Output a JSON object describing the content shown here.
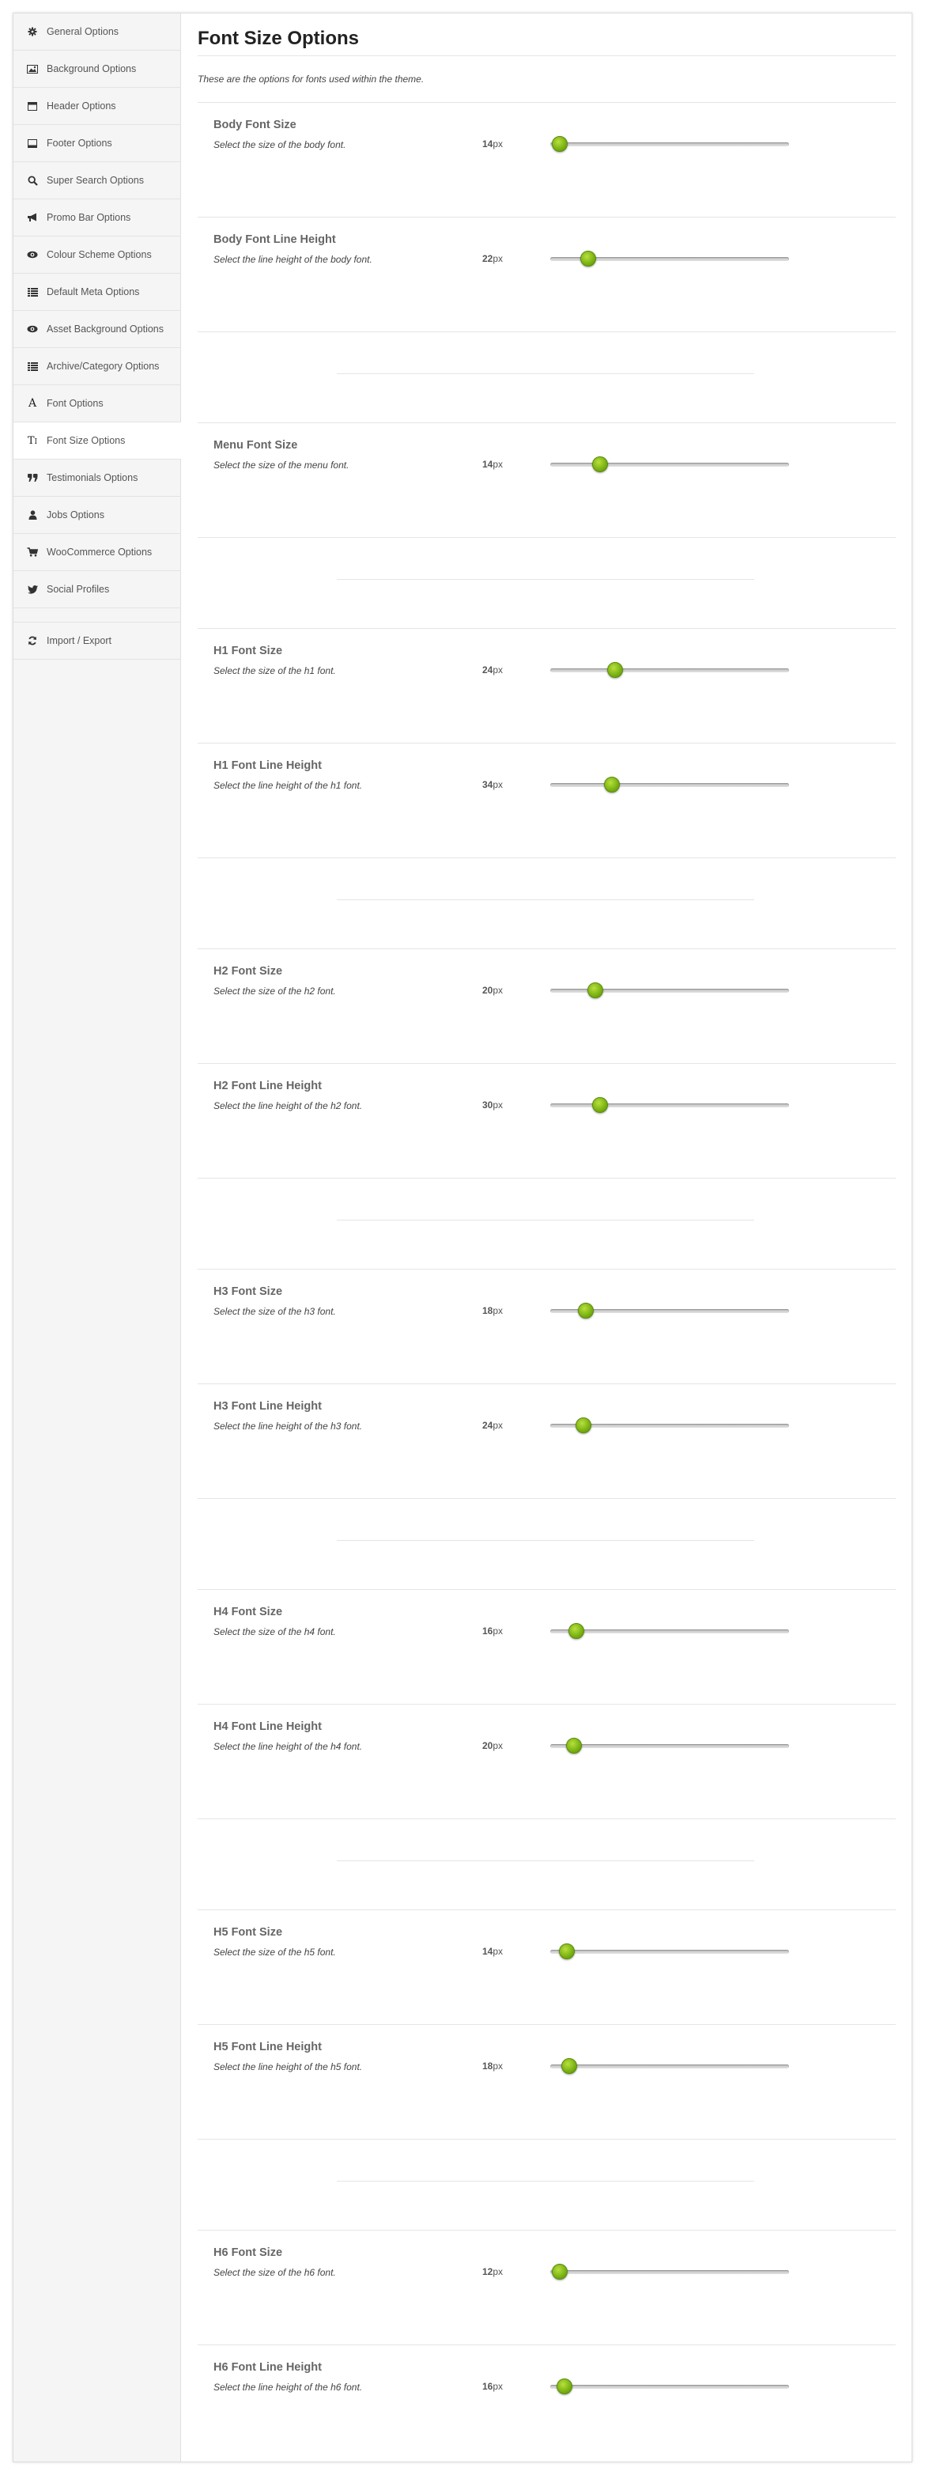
{
  "sidebar": {
    "items": [
      {
        "label": "General Options",
        "icon": "gear-icon",
        "active": false
      },
      {
        "label": "Background Options",
        "icon": "image-icon",
        "active": false
      },
      {
        "label": "Header Options",
        "icon": "header-icon",
        "active": false
      },
      {
        "label": "Footer Options",
        "icon": "footer-icon",
        "active": false
      },
      {
        "label": "Super Search Options",
        "icon": "search-icon",
        "active": false
      },
      {
        "label": "Promo Bar Options",
        "icon": "megaphone-icon",
        "active": false
      },
      {
        "label": "Colour Scheme Options",
        "icon": "eye-icon",
        "active": false
      },
      {
        "label": "Default Meta Options",
        "icon": "list-icon",
        "active": false
      },
      {
        "label": "Asset Background Options",
        "icon": "eye-icon",
        "active": false
      },
      {
        "label": "Archive/Category Options",
        "icon": "list-icon",
        "active": false
      },
      {
        "label": "Font Options",
        "icon": "font-icon",
        "active": false
      },
      {
        "label": "Font Size Options",
        "icon": "text-size-icon",
        "active": true
      },
      {
        "label": "Testimonials Options",
        "icon": "quote-icon",
        "active": false
      },
      {
        "label": "Jobs Options",
        "icon": "user-icon",
        "active": false
      },
      {
        "label": "WooCommerce Options",
        "icon": "cart-icon",
        "active": false
      },
      {
        "label": "Social Profiles",
        "icon": "twitter-icon",
        "active": false
      }
    ],
    "footer_item": {
      "label": "Import / Export",
      "icon": "refresh-icon"
    }
  },
  "main": {
    "title": "Font Size Options",
    "intro": "These are the options for fonts used within the theme.",
    "unit": "px",
    "slider_range": [
      12,
      60
    ],
    "options": [
      {
        "title": "Body Font Size",
        "desc": "Select the size of the body font.",
        "value": "14"
      },
      {
        "title": "Body Font Line Height",
        "desc": "Select the line height of the body font.",
        "value": "22"
      },
      {
        "title": "Menu Font Size",
        "desc": "Select the size of the menu font.",
        "value": "14"
      },
      {
        "title": "H1 Font Size",
        "desc": "Select the size of the h1 font.",
        "value": "24"
      },
      {
        "title": "H1 Font Line Height",
        "desc": "Select the line height of the h1 font.",
        "value": "34"
      },
      {
        "title": "H2 Font Size",
        "desc": "Select the size of the h2 font.",
        "value": "20"
      },
      {
        "title": "H2 Font Line Height",
        "desc": "Select the line height of the h2 font.",
        "value": "30"
      },
      {
        "title": "H3 Font Size",
        "desc": "Select the size of the h3 font.",
        "value": "18"
      },
      {
        "title": "H3 Font Line Height",
        "desc": "Select the line height of the h3 font.",
        "value": "24"
      },
      {
        "title": "H4 Font Size",
        "desc": "Select the size of the h4 font.",
        "value": "16"
      },
      {
        "title": "H4 Font Line Height",
        "desc": "Select the line height of the h4 font.",
        "value": "20"
      },
      {
        "title": "H5 Font Size",
        "desc": "Select the size of the h5 font.",
        "value": "14"
      },
      {
        "title": "H5 Font Line Height",
        "desc": "Select the line height of the h5 font.",
        "value": "18"
      },
      {
        "title": "H6 Font Size",
        "desc": "Select the size of the h6 font.",
        "value": "12"
      },
      {
        "title": "H6 Font Line Height",
        "desc": "Select the line height of the h6 font.",
        "value": "16"
      }
    ],
    "slider_fractions": [
      0.02,
      0.14,
      0.19,
      0.25,
      0.24,
      0.17,
      0.19,
      0.13,
      0.12,
      0.09,
      0.08,
      0.05,
      0.06,
      0.02,
      0.04
    ]
  },
  "colors": {
    "thumb": "#78b012",
    "sidebar_bg": "#f5f5f5",
    "title": "#222222"
  }
}
